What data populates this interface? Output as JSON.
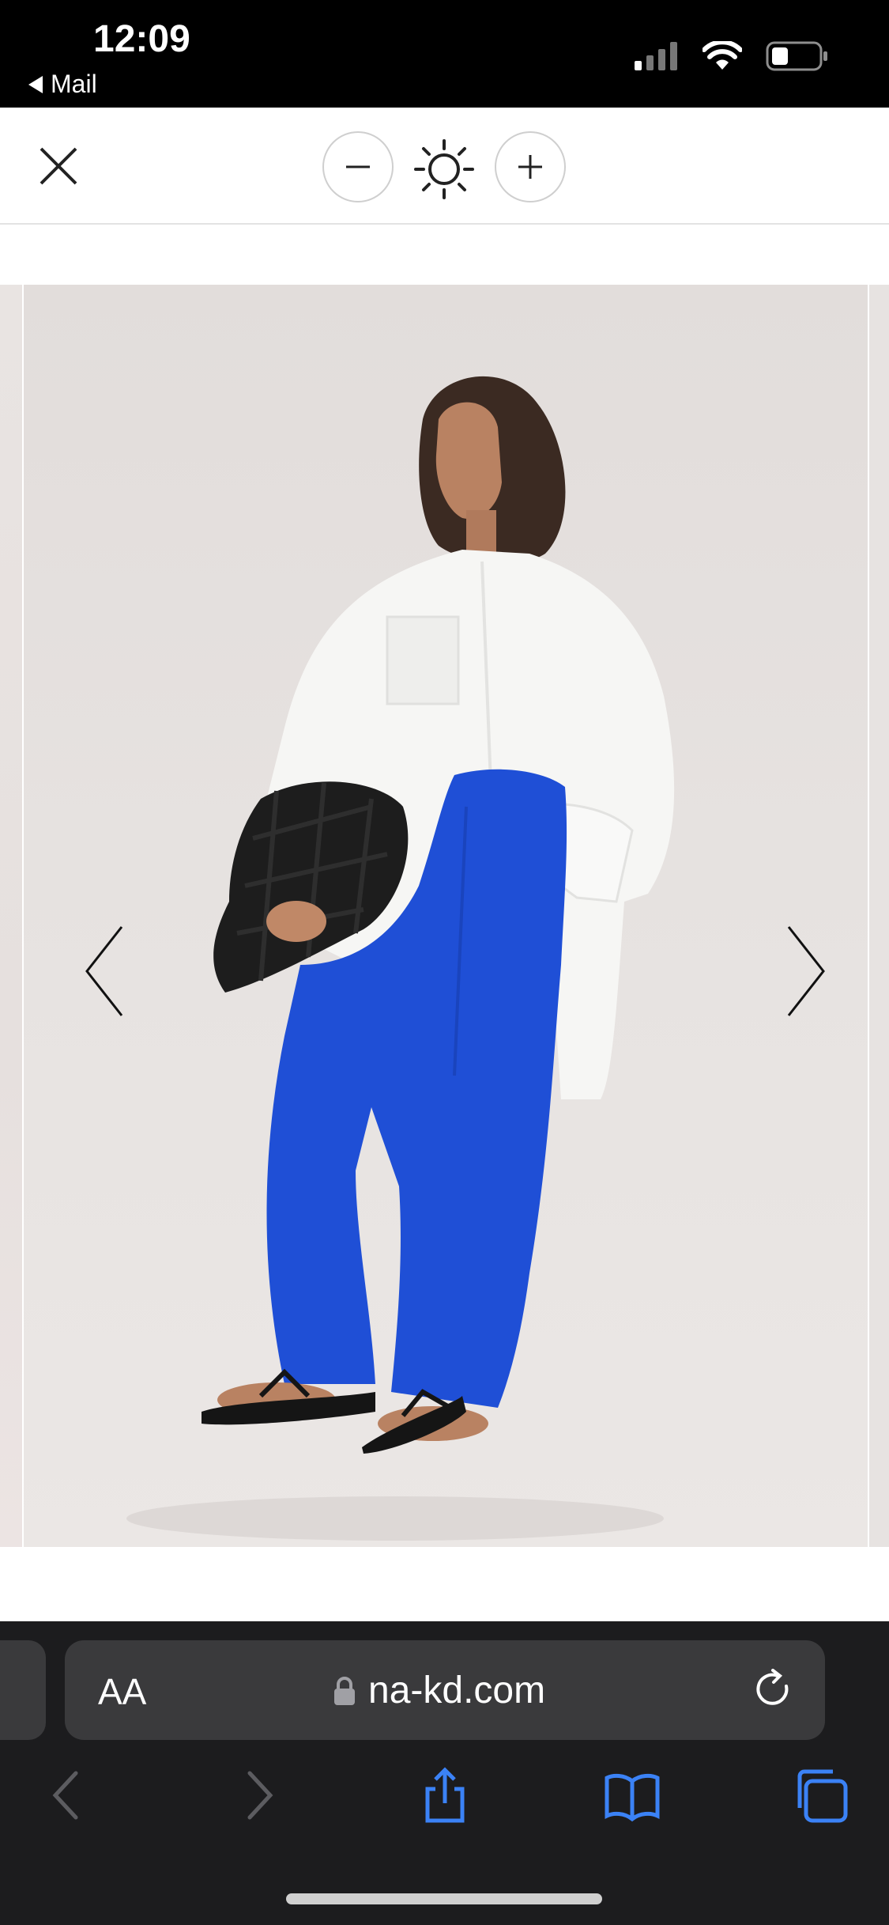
{
  "status_bar": {
    "time": "12:09",
    "back_app": "Mail",
    "icons": [
      "cellular-signal-icon",
      "wifi-icon",
      "battery-icon"
    ]
  },
  "viewer_toolbar": {
    "close_icon": "close-icon",
    "zoom_out_icon": "minus-icon",
    "brightness_icon": "sun-icon",
    "zoom_in_icon": "plus-icon"
  },
  "gallery": {
    "image_description": "product photo",
    "prev_icon": "chevron-left-icon",
    "next_icon": "chevron-right-icon",
    "colors": {
      "pants": "#1f4fd6",
      "shirt": "#f6f6f4",
      "bag": "#1d1d1d",
      "backdrop": "#e6e1df"
    }
  },
  "browser": {
    "text_size_label": "AA",
    "url": "na-kd.com",
    "lock_icon": "lock-icon",
    "reload_icon": "reload-icon",
    "toolbar": [
      "back-icon",
      "forward-icon",
      "share-icon",
      "bookmarks-icon",
      "tabs-icon"
    ],
    "accent": "#3b82f6"
  }
}
